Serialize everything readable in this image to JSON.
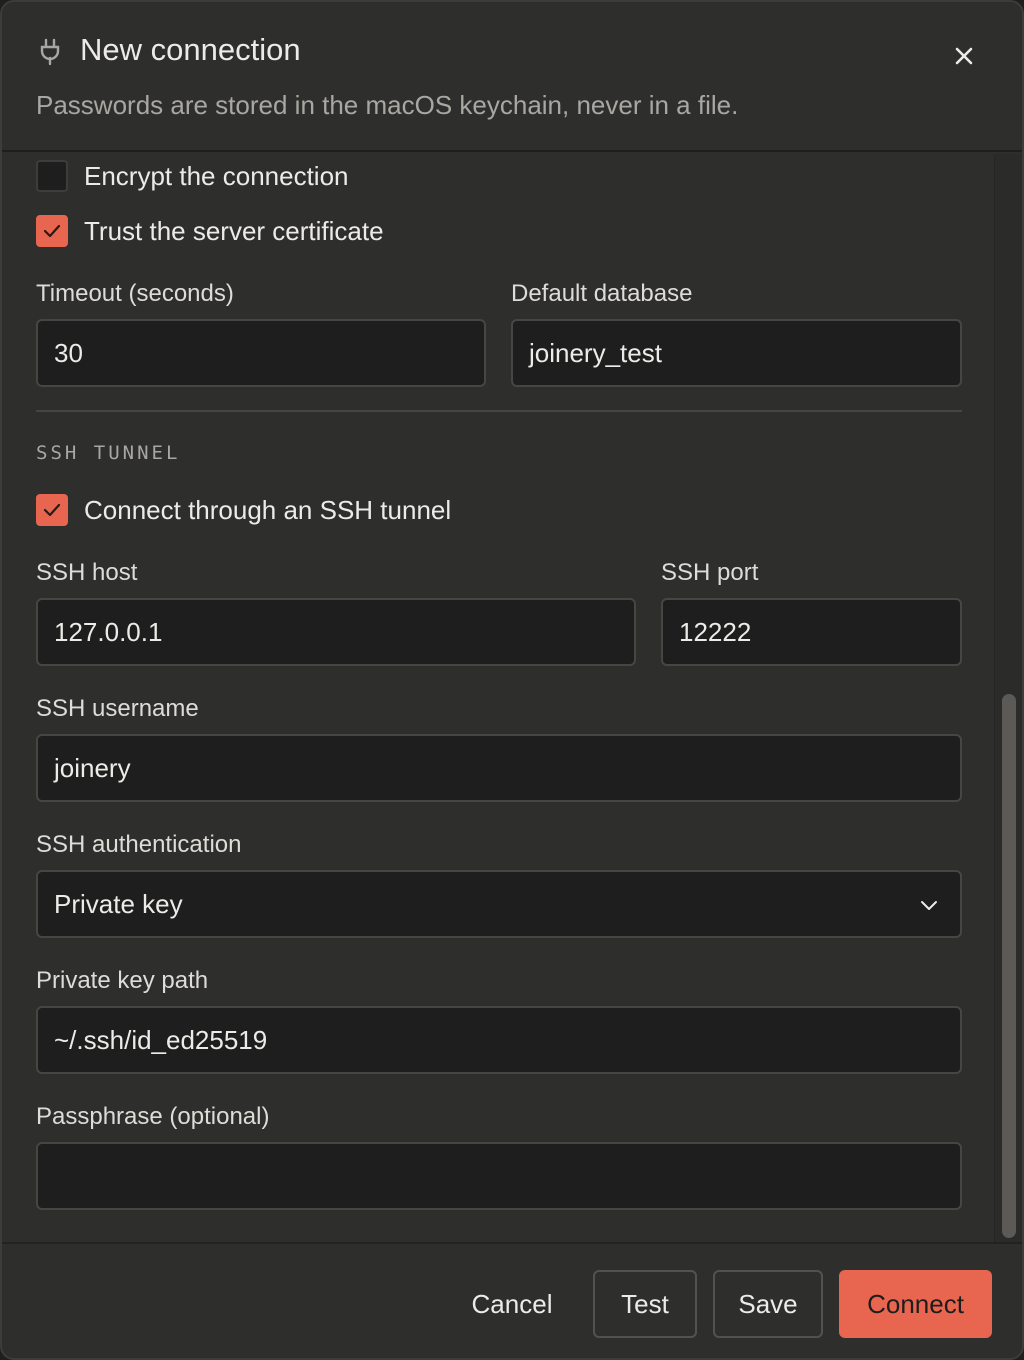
{
  "dialog": {
    "icon": "plug-icon",
    "title": "New connection",
    "subtitle": "Passwords are stored in the macOS keychain, never in a file."
  },
  "options": {
    "encrypt": {
      "label": "Encrypt the connection",
      "checked": false
    },
    "trust_cert": {
      "label": "Trust the server certificate",
      "checked": true
    }
  },
  "fields": {
    "timeout": {
      "label": "Timeout (seconds)",
      "value": "30"
    },
    "default_db": {
      "label": "Default database",
      "value": "joinery_test"
    }
  },
  "ssh": {
    "section_title": "SSH TUNNEL",
    "enabled": {
      "label": "Connect through an SSH tunnel",
      "checked": true
    },
    "host": {
      "label": "SSH host",
      "value": "127.0.0.1"
    },
    "port": {
      "label": "SSH port",
      "value": "12222"
    },
    "username": {
      "label": "SSH username",
      "value": "joinery"
    },
    "auth": {
      "label": "SSH authentication",
      "value": "Private key"
    },
    "key_path": {
      "label": "Private key path",
      "value": "~/.ssh/id_ed25519"
    },
    "passphrase": {
      "label": "Passphrase (optional)",
      "value": ""
    }
  },
  "footer": {
    "cancel": "Cancel",
    "test": "Test",
    "save": "Save",
    "connect": "Connect"
  },
  "colors": {
    "accent": "#e8664f",
    "background": "#2e2e2c",
    "input_background": "#1e1e1e"
  }
}
